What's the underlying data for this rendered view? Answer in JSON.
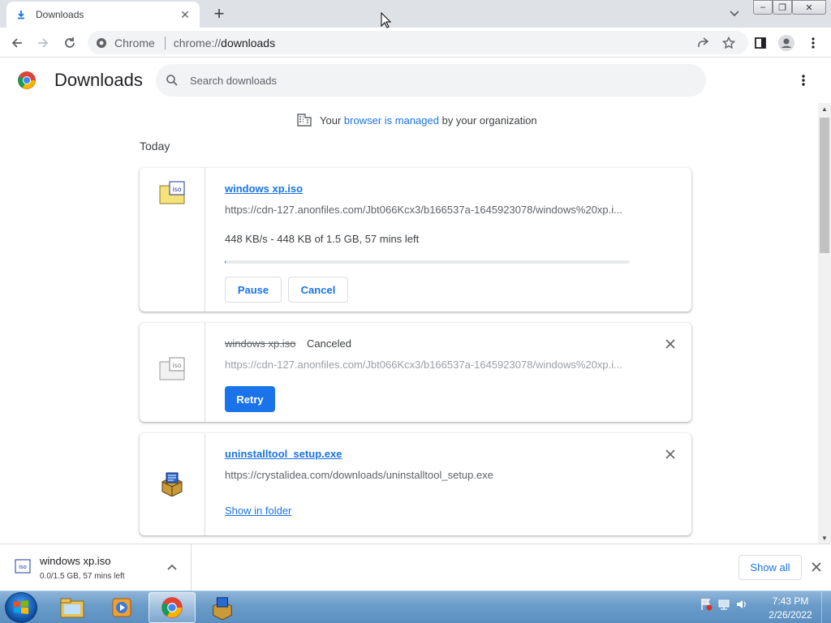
{
  "tab": {
    "title": "Downloads",
    "icon": "download-icon"
  },
  "toolbar": {
    "site_label": "Chrome",
    "url_scheme": "chrome://",
    "url_path": "downloads"
  },
  "header": {
    "title": "Downloads",
    "search_placeholder": "Search downloads"
  },
  "managed": {
    "prefix": "Your",
    "link": "browser is managed",
    "suffix": "by your organization"
  },
  "section_label": "Today",
  "downloads": [
    {
      "file_name": "windows xp.iso",
      "url": "https://cdn-127.anonfiles.com/Jbt066Kcx3/b166537a-1645923078/windows%20xp.i...",
      "progress_text": "448 KB/s - 448 KB of 1.5 GB, 57 mins left",
      "progress_fraction": 0.0003,
      "pause_label": "Pause",
      "cancel_label": "Cancel",
      "icon": "iso-file-icon"
    },
    {
      "file_name": "windows xp.iso",
      "status": "Canceled",
      "url": "https://cdn-127.anonfiles.com/Jbt066Kcx3/b166537a-1645923078/windows%20xp.i...",
      "retry_label": "Retry",
      "icon": "iso-file-icon"
    },
    {
      "file_name": "uninstalltool_setup.exe",
      "url": "https://crystalidea.com/downloads/uninstalltool_setup.exe",
      "show_in_folder_label": "Show in folder",
      "icon": "installer-icon"
    }
  ],
  "shelf": {
    "item_name": "windows xp.iso",
    "item_status": "0.0/1.5 GB, 57 mins left",
    "show_all_label": "Show all"
  },
  "taskbar": {
    "time": "7:43 PM",
    "date": "2/26/2022",
    "apps": [
      "file-explorer-icon",
      "media-player-icon",
      "chrome-icon",
      "installer-icon"
    ]
  },
  "colors": {
    "accent": "#1a73e8",
    "taskbar": "#6a9cc9"
  }
}
